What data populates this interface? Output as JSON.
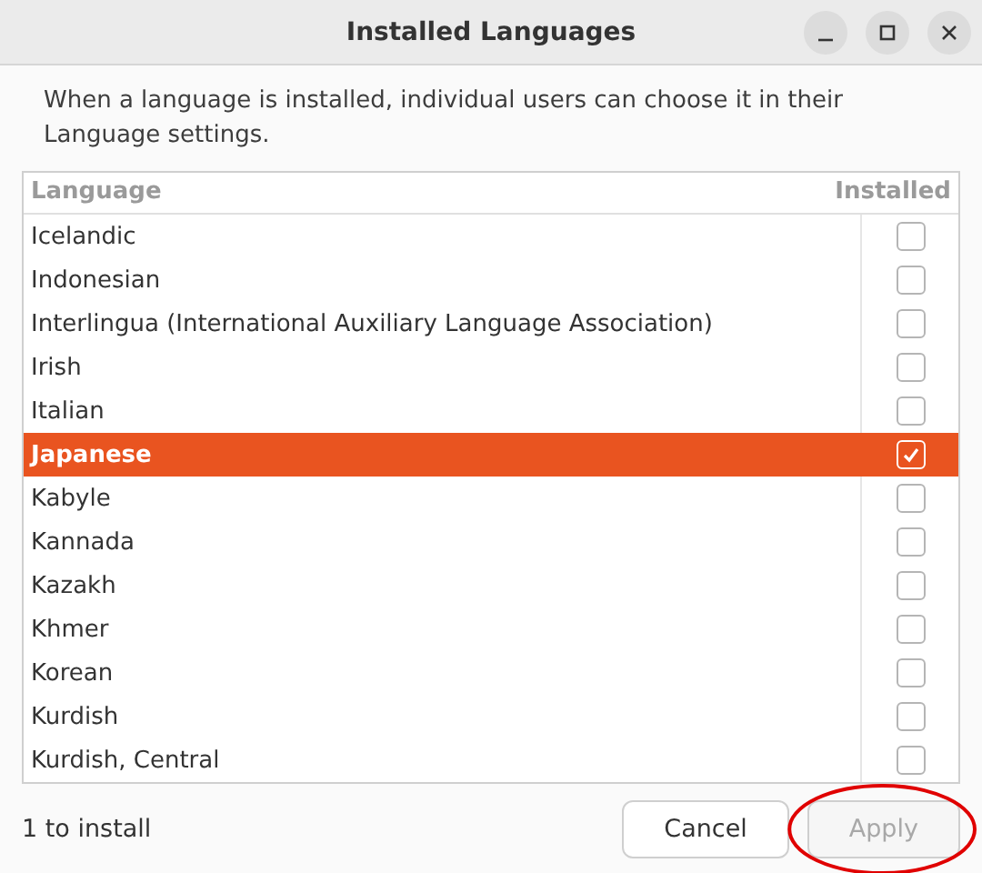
{
  "window": {
    "title": "Installed Languages"
  },
  "description": "When a language is installed, individual users can choose it in their Language settings.",
  "table": {
    "columns": [
      "Language",
      "Installed"
    ],
    "rows": [
      {
        "name": "Icelandic",
        "installed": false,
        "selected": false
      },
      {
        "name": "Indonesian",
        "installed": false,
        "selected": false
      },
      {
        "name": "Interlingua (International Auxiliary Language Association)",
        "installed": false,
        "selected": false
      },
      {
        "name": "Irish",
        "installed": false,
        "selected": false
      },
      {
        "name": "Italian",
        "installed": false,
        "selected": false
      },
      {
        "name": "Japanese",
        "installed": true,
        "selected": true
      },
      {
        "name": "Kabyle",
        "installed": false,
        "selected": false
      },
      {
        "name": "Kannada",
        "installed": false,
        "selected": false
      },
      {
        "name": "Kazakh",
        "installed": false,
        "selected": false
      },
      {
        "name": "Khmer",
        "installed": false,
        "selected": false
      },
      {
        "name": "Korean",
        "installed": false,
        "selected": false
      },
      {
        "name": "Kurdish",
        "installed": false,
        "selected": false
      },
      {
        "name": "Kurdish, Central",
        "installed": false,
        "selected": false
      }
    ]
  },
  "status": "1 to install",
  "buttons": [
    {
      "label": "Cancel",
      "disabled": false,
      "circled": false
    },
    {
      "label": "Apply",
      "disabled": true,
      "circled": true
    }
  ]
}
